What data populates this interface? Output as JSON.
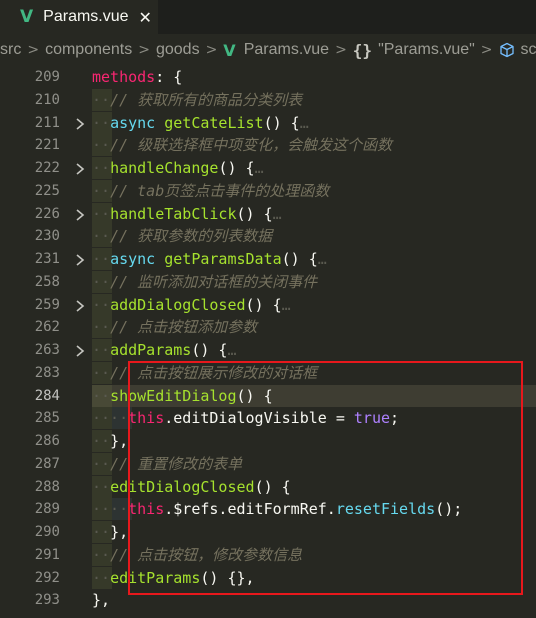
{
  "tab": {
    "title": "Params.vue",
    "close_glyph": "✕",
    "icon": "vue-icon"
  },
  "breadcrumb": {
    "items": [
      "src",
      "components",
      "goods",
      "Params.vue",
      "\"Params.vue\"",
      "scr"
    ],
    "icons": [
      "vue-icon",
      "braces-icon",
      "cube-icon"
    ]
  },
  "colors": {
    "background": "#272822",
    "comment": "#75715e",
    "keyword": "#f92672",
    "function": "#a6e22e",
    "storage": "#66d9ef",
    "boolean": "#ae81ff",
    "highlight_box": "#e8181c",
    "current_line": "#3e3d32"
  },
  "lines": [
    {
      "num": "209",
      "indent": 0,
      "fold": false,
      "tokens": [
        [
          "methods",
          "kw"
        ],
        [
          ": {",
          "p"
        ]
      ]
    },
    {
      "num": "210",
      "indent": 1,
      "fold": false,
      "tokens": [
        [
          "// 获取所有的商品分类列表",
          "cm"
        ]
      ]
    },
    {
      "num": "211",
      "indent": 1,
      "fold": true,
      "tokens": [
        [
          "async",
          "st"
        ],
        [
          " ",
          "p"
        ],
        [
          "getCateList",
          "fn"
        ],
        [
          "() {",
          "p"
        ],
        [
          "…",
          "dotl"
        ]
      ]
    },
    {
      "num": "221",
      "indent": 1,
      "fold": false,
      "tokens": [
        [
          "// 级联选择框中项变化，会触发这个函数",
          "cm"
        ]
      ]
    },
    {
      "num": "222",
      "indent": 1,
      "fold": true,
      "tokens": [
        [
          "handleChange",
          "fn"
        ],
        [
          "() {",
          "p"
        ],
        [
          "…",
          "dotl"
        ]
      ]
    },
    {
      "num": "225",
      "indent": 1,
      "fold": false,
      "tokens": [
        [
          "// tab页签点击事件的处理函数",
          "cm"
        ]
      ]
    },
    {
      "num": "226",
      "indent": 1,
      "fold": true,
      "tokens": [
        [
          "handleTabClick",
          "fn"
        ],
        [
          "() {",
          "p"
        ],
        [
          "…",
          "dotl"
        ]
      ]
    },
    {
      "num": "230",
      "indent": 1,
      "fold": false,
      "tokens": [
        [
          "// 获取参数的列表数据",
          "cm"
        ]
      ]
    },
    {
      "num": "231",
      "indent": 1,
      "fold": true,
      "tokens": [
        [
          "async",
          "st"
        ],
        [
          " ",
          "p"
        ],
        [
          "getParamsData",
          "fn"
        ],
        [
          "() {",
          "p"
        ],
        [
          "…",
          "dotl"
        ]
      ]
    },
    {
      "num": "258",
      "indent": 1,
      "fold": false,
      "tokens": [
        [
          "// 监听添加对话框的关闭事件",
          "cm"
        ]
      ]
    },
    {
      "num": "259",
      "indent": 1,
      "fold": true,
      "tokens": [
        [
          "addDialogClosed",
          "fn"
        ],
        [
          "() {",
          "p"
        ],
        [
          "…",
          "dotl"
        ]
      ]
    },
    {
      "num": "262",
      "indent": 1,
      "fold": false,
      "tokens": [
        [
          "// 点击按钮添加参数",
          "cm"
        ]
      ]
    },
    {
      "num": "263",
      "indent": 1,
      "fold": true,
      "tokens": [
        [
          "addParams",
          "fn"
        ],
        [
          "() {",
          "p"
        ],
        [
          "…",
          "dotl"
        ]
      ]
    },
    {
      "num": "283",
      "indent": 1,
      "fold": false,
      "tokens": [
        [
          "// 点击按钮展示修改的对话框",
          "cm"
        ]
      ]
    },
    {
      "num": "284",
      "indent": 1,
      "fold": false,
      "current": true,
      "tokens": [
        [
          "showEditDialog",
          "fn"
        ],
        [
          "() {",
          "p"
        ]
      ]
    },
    {
      "num": "285",
      "indent": 2,
      "fold": false,
      "tokens": [
        [
          "this",
          "kw"
        ],
        [
          ".editDialogVisible = ",
          "p"
        ],
        [
          "true",
          "tr"
        ],
        [
          ";",
          "p"
        ]
      ]
    },
    {
      "num": "286",
      "indent": 1,
      "fold": false,
      "tokens": [
        [
          "},",
          "p"
        ]
      ]
    },
    {
      "num": "287",
      "indent": 1,
      "fold": false,
      "tokens": [
        [
          "// 重置修改的表单",
          "cm"
        ]
      ]
    },
    {
      "num": "288",
      "indent": 1,
      "fold": false,
      "tokens": [
        [
          "editDialogClosed",
          "fn"
        ],
        [
          "() {",
          "p"
        ]
      ]
    },
    {
      "num": "289",
      "indent": 2,
      "fold": false,
      "tokens": [
        [
          "this",
          "kw"
        ],
        [
          ".$refs.editFormRef.",
          "p"
        ],
        [
          "resetFields",
          "st"
        ],
        [
          "();",
          "p"
        ]
      ]
    },
    {
      "num": "290",
      "indent": 1,
      "fold": false,
      "tokens": [
        [
          "},",
          "p"
        ]
      ]
    },
    {
      "num": "291",
      "indent": 1,
      "fold": false,
      "tokens": [
        [
          "// 点击按钮，修改参数信息",
          "cm"
        ]
      ]
    },
    {
      "num": "292",
      "indent": 1,
      "fold": false,
      "tokens": [
        [
          "editParams",
          "fn"
        ],
        [
          "() {},",
          "p"
        ]
      ]
    },
    {
      "num": "293",
      "indent": 0,
      "fold": false,
      "tokens": [
        [
          "},",
          "p"
        ]
      ]
    }
  ]
}
